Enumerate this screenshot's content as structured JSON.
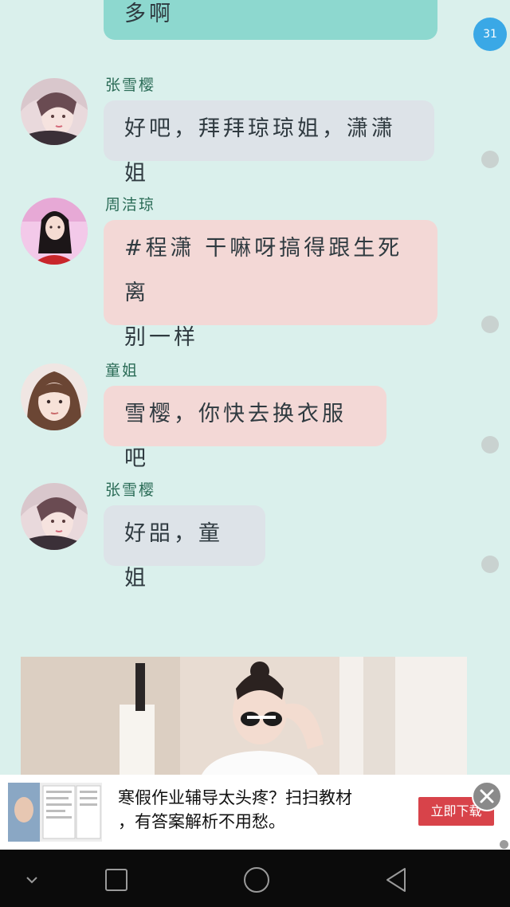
{
  "page_badge": "31",
  "messages": [
    {
      "sender": "",
      "text": "多啊",
      "style": "teal"
    },
    {
      "sender": "张雪樱",
      "text": "好吧，拜拜琼琼姐，潇潇姐",
      "style": "blue"
    },
    {
      "sender": "周洁琼",
      "text_line1": "#程潇 干嘛呀搞得跟生死离",
      "text_line2": "别一样",
      "style": "pink"
    },
    {
      "sender": "童姐",
      "text": "雪樱，你快去换衣服吧",
      "style": "pink"
    },
    {
      "sender": "张雪樱",
      "text": "好㗊，童姐",
      "style": "blue"
    }
  ],
  "ad": {
    "text_line1": "寒假作业辅导太头疼？扫扫教材",
    "text_line2": "，有答案解析不用愁。",
    "button_label": "立即下载"
  },
  "navbar": {
    "icons": [
      "chevron-down-icon",
      "recents-square-icon",
      "home-circle-icon",
      "back-triangle-icon"
    ]
  },
  "colors": {
    "background": "#daf0ec",
    "teal_bubble": "#8dd8cf",
    "blue_bubble": "#dde3e8",
    "pink_bubble": "#f3d8d6",
    "sender_name": "#2a6b56",
    "badge": "#3aa8e6",
    "ad_button": "#d8434a"
  }
}
